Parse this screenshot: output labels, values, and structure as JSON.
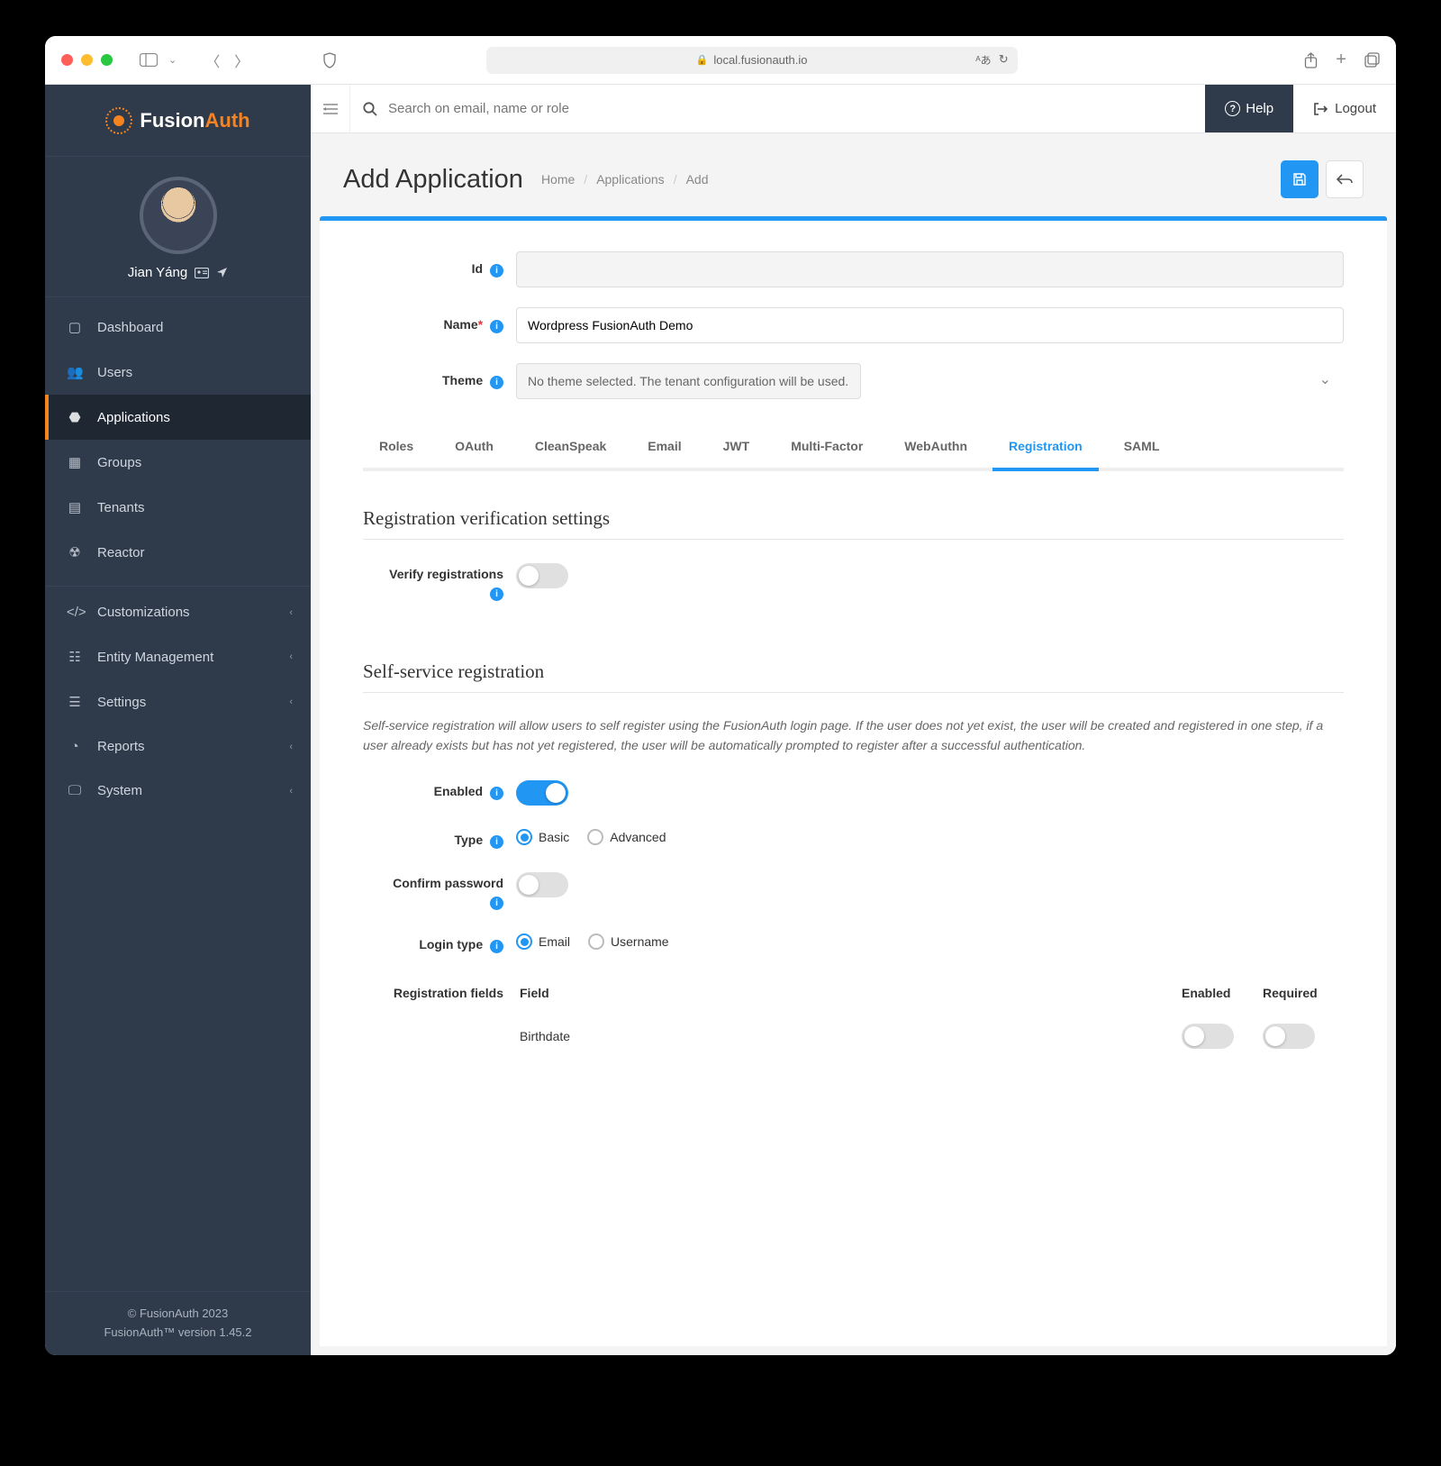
{
  "browser": {
    "url_host": "local.fusionauth.io"
  },
  "brand": {
    "name1": "Fusion",
    "name2": "Auth"
  },
  "user": {
    "name": "Jian Yáng"
  },
  "sidebar": {
    "items": [
      {
        "label": "Dashboard"
      },
      {
        "label": "Users"
      },
      {
        "label": "Applications"
      },
      {
        "label": "Groups"
      },
      {
        "label": "Tenants"
      },
      {
        "label": "Reactor"
      }
    ],
    "groups": [
      {
        "label": "Customizations"
      },
      {
        "label": "Entity Management"
      },
      {
        "label": "Settings"
      },
      {
        "label": "Reports"
      },
      {
        "label": "System"
      }
    ]
  },
  "footer": {
    "copyright": "© FusionAuth 2023",
    "version": "FusionAuth™ version 1.45.2"
  },
  "topbar": {
    "search_placeholder": "Search on email, name or role",
    "help": "Help",
    "logout": "Logout"
  },
  "header": {
    "title": "Add Application",
    "crumbs": [
      "Home",
      "Applications",
      "Add"
    ]
  },
  "form": {
    "id_label": "Id",
    "id_value": "",
    "name_label": "Name",
    "name_value": "Wordpress FusionAuth Demo",
    "theme_label": "Theme",
    "theme_value": "No theme selected. The tenant configuration will be used."
  },
  "tabs": [
    "Roles",
    "OAuth",
    "CleanSpeak",
    "Email",
    "JWT",
    "Multi-Factor",
    "WebAuthn",
    "Registration",
    "SAML"
  ],
  "active_tab": "Registration",
  "section1": {
    "title": "Registration verification settings",
    "verify_label": "Verify registrations",
    "verify_on": false
  },
  "section2": {
    "title": "Self-service registration",
    "desc": "Self-service registration will allow users to self register using the FusionAuth login page. If the user does not yet exist, the user will be created and registered in one step, if a user already exists but has not yet registered, the user will be automatically prompted to register after a successful authentication.",
    "enabled_label": "Enabled",
    "enabled_on": true,
    "type_label": "Type",
    "type_options": [
      "Basic",
      "Advanced"
    ],
    "type_selected": "Basic",
    "confirm_label": "Confirm password",
    "confirm_on": false,
    "login_label": "Login type",
    "login_options": [
      "Email",
      "Username"
    ],
    "login_selected": "Email",
    "reg_fields_label": "Registration fields",
    "col_field": "Field",
    "col_enabled": "Enabled",
    "col_required": "Required",
    "rows": [
      {
        "field": "Birthdate",
        "enabled": false,
        "required": false
      }
    ]
  }
}
